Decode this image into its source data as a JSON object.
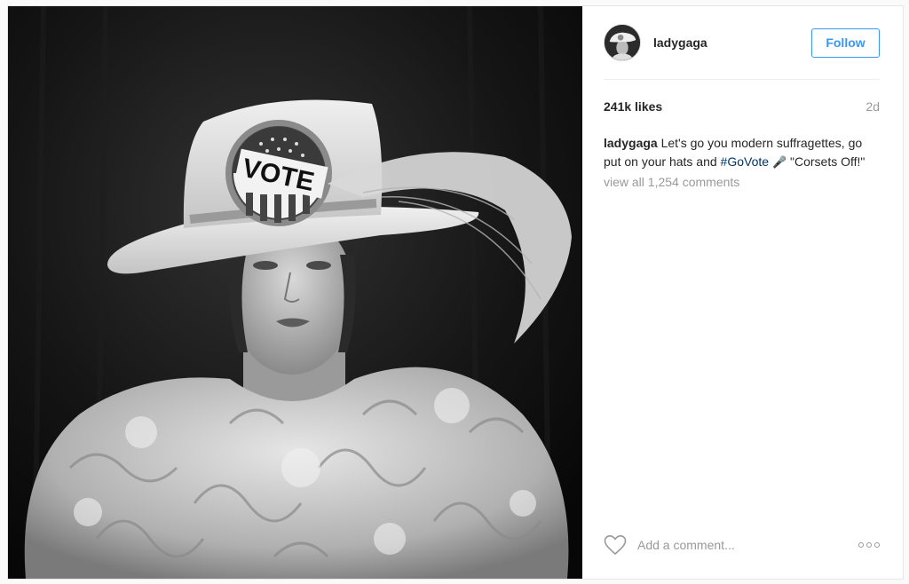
{
  "post": {
    "image_alt": "Black and white photo of a woman in a wide-brimmed hat with a VOTE badge and a large feather, wearing a ruffled tulle collar",
    "badge_text": "VOTE",
    "user": {
      "username": "ladygaga"
    },
    "follow_label": "Follow",
    "likes": "241k likes",
    "time_ago": "2d",
    "caption": {
      "username": "ladygaga",
      "text_before": "Let's go you modern suffragettes, go put on your hats and",
      "hashtag": "#GoVote",
      "emoji": "🎤",
      "text_after": "\"Corsets Off!\""
    },
    "view_comments": "view all 1,254 comments",
    "comment_placeholder": "Add a comment...",
    "colors": {
      "accent": "#3897f0",
      "hashtag": "#003569",
      "muted": "#999999"
    },
    "icons": {
      "like": "heart-icon",
      "more": "more-options-icon"
    }
  }
}
